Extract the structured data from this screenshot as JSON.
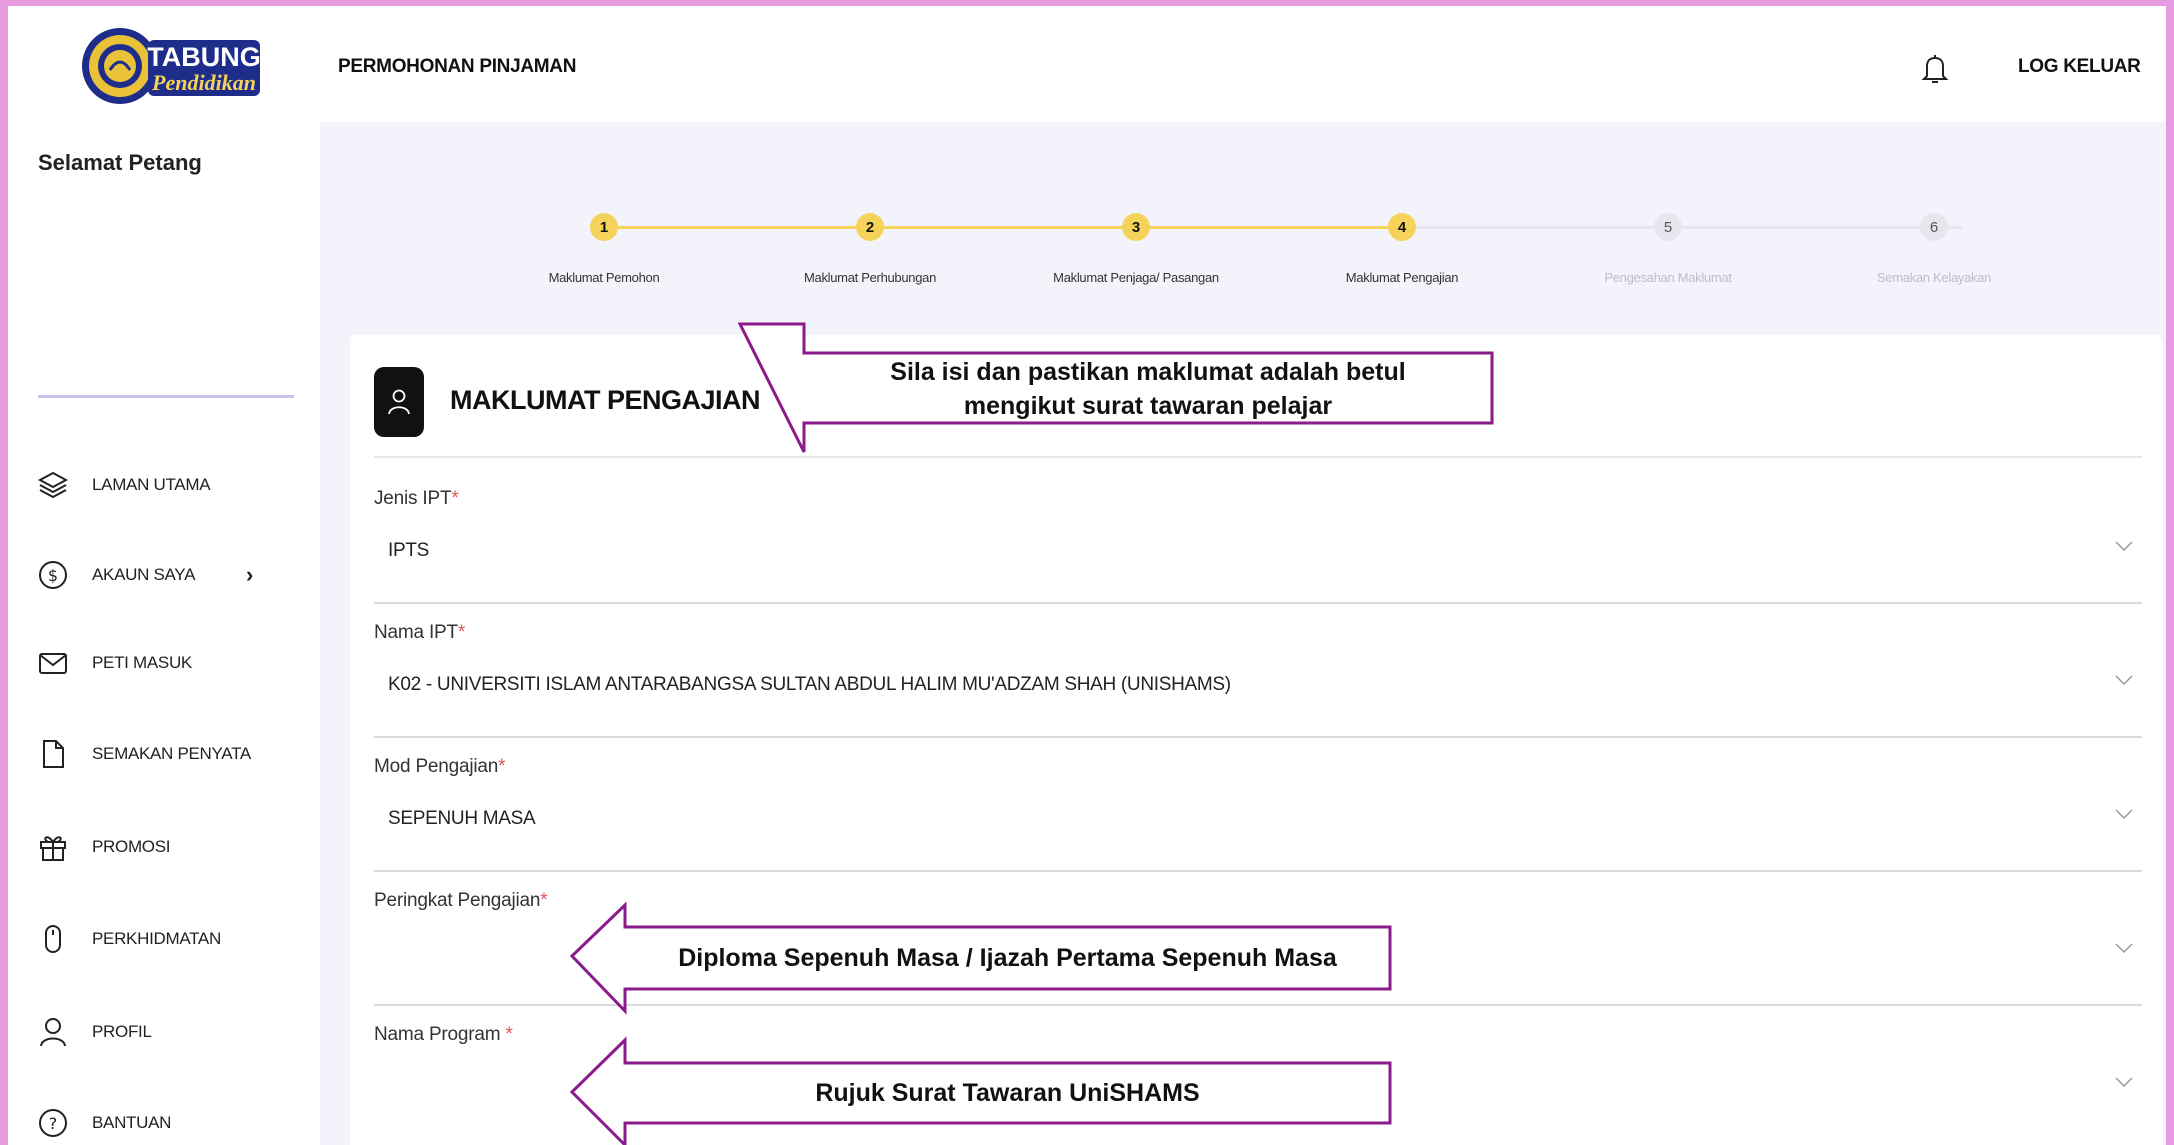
{
  "brand": {
    "logo_line1": "TABUNG",
    "logo_line2": "Pendidikan"
  },
  "sidebar": {
    "greeting": "Selamat Petang",
    "items": [
      {
        "label": "LAMAN UTAMA",
        "icon": "layers-icon"
      },
      {
        "label": "AKAUN SAYA",
        "icon": "dollar-icon",
        "chevron": "›"
      },
      {
        "label": "PETI MASUK",
        "icon": "mail-icon"
      },
      {
        "label": "SEMAKAN PENYATA",
        "icon": "document-icon"
      },
      {
        "label": "PROMOSI",
        "icon": "gift-icon"
      },
      {
        "label": "PERKHIDMATAN",
        "icon": "mouse-icon"
      },
      {
        "label": "PROFIL",
        "icon": "user-icon"
      },
      {
        "label": "BANTUAN",
        "icon": "help-icon"
      }
    ]
  },
  "header": {
    "title": "PERMOHONAN PINJAMAN",
    "logout": "LOG KELUAR"
  },
  "stepper": {
    "steps": [
      {
        "number": "1",
        "label": "Maklumat Pemohon",
        "state": "done"
      },
      {
        "number": "2",
        "label": "Maklumat Perhubungan",
        "state": "done"
      },
      {
        "number": "3",
        "label": "Maklumat Penjaga/ Pasangan",
        "state": "done"
      },
      {
        "number": "4",
        "label": "Maklumat Pengajian",
        "state": "done"
      },
      {
        "number": "5",
        "label": "Pengesahan Maklumat",
        "state": "todo"
      },
      {
        "number": "6",
        "label": "Semakan Kelayakan",
        "state": "todo"
      }
    ]
  },
  "form": {
    "title": "MAKLUMAT PENGAJIAN",
    "fields": [
      {
        "label": "Jenis IPT",
        "required": "*",
        "value": "IPTS"
      },
      {
        "label": "Nama IPT",
        "required": "*",
        "value": "K02 - UNIVERSITI ISLAM ANTARABANGSA SULTAN ABDUL HALIM MU'ADZAM SHAH (UNISHAMS)"
      },
      {
        "label": "Mod Pengajian",
        "required": "*",
        "value": "SEPENUH MASA"
      },
      {
        "label": "Peringkat Pengajian",
        "required": "*",
        "value": ""
      },
      {
        "label": "Nama Program ",
        "required": "*",
        "value": ""
      }
    ]
  },
  "annotations": {
    "callout1_line1": "Sila isi dan pastikan maklumat adalah betul",
    "callout1_line2": "mengikut surat tawaran pelajar",
    "callout2": "Diploma Sepenuh Masa / Ijazah Pertama Sepenuh Masa",
    "callout3": "Rujuk Surat Tawaran UniSHAMS",
    "border_color": "#8b1a8b"
  },
  "colors": {
    "accent": "#f5d35a",
    "page_border": "#e79ae0",
    "main_bg": "#f3f4fb"
  }
}
